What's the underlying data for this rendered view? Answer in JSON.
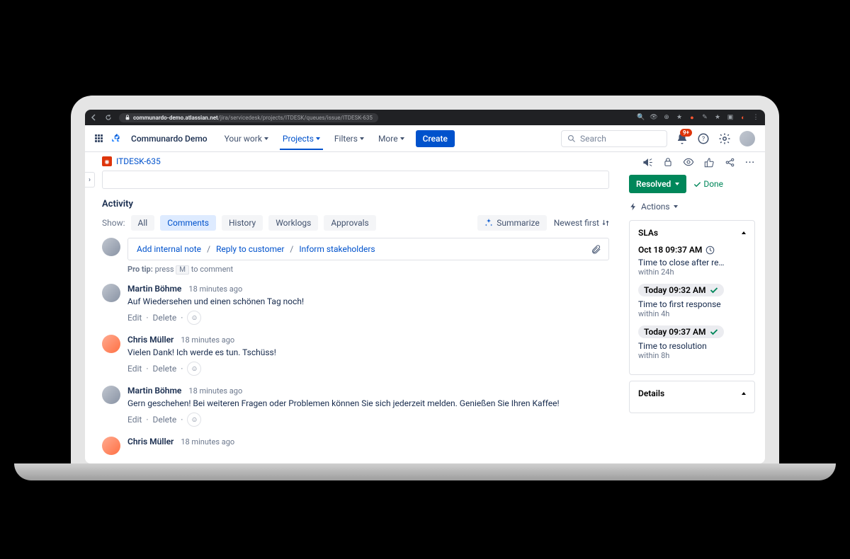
{
  "browser": {
    "url_host": "communardo-demo.atlassian.net",
    "url_path": "/jira/servicedesk/projects/ITDESK/queues/issue/ITDESK-635"
  },
  "topnav": {
    "site": "Communardo Demo",
    "items": [
      "Your work",
      "Projects",
      "Filters",
      "More"
    ],
    "active_index": 1,
    "create": "Create",
    "search_placeholder": "Search",
    "notif_count": "9+"
  },
  "issue": {
    "key": "ITDESK-635"
  },
  "activity": {
    "title": "Activity",
    "show_label": "Show:",
    "tabs": [
      "All",
      "Comments",
      "History",
      "Worklogs",
      "Approvals"
    ],
    "active_tab": 1,
    "summarize": "Summarize",
    "sort": "Newest first",
    "compose_links": [
      "Add internal note",
      "Reply to customer",
      "Inform stakeholders"
    ],
    "protip_prefix": "Pro tip:",
    "protip_press": "press",
    "protip_key": "M",
    "protip_suffix": "to comment",
    "edit": "Edit",
    "delete": "Delete",
    "comments": [
      {
        "author": "Martin Böhme",
        "time": "18 minutes ago",
        "text": "Auf Wiedersehen und einen schönen Tag noch!",
        "avatar": 1
      },
      {
        "author": "Chris Müller",
        "time": "18 minutes ago",
        "text": "Vielen Dank! Ich werde es tun. Tschüss!",
        "avatar": 2
      },
      {
        "author": "Martin Böhme",
        "time": "18 minutes ago",
        "text": "Gern geschehen! Bei weiteren Fragen oder Problemen können Sie sich jederzeit melden. Genießen Sie Ihren Kaffee!",
        "avatar": 1
      },
      {
        "author": "Chris Müller",
        "time": "18 minutes ago",
        "text": "",
        "avatar": 2
      }
    ]
  },
  "side": {
    "status": "Resolved",
    "done": "Done",
    "actions": "Actions",
    "slas_title": "SLAs",
    "details_title": "Details",
    "slas": [
      {
        "date": "Oct 18 09:37 AM",
        "desc": "Time to close after re…",
        "sub": "within 24h",
        "icon": "clock"
      },
      {
        "date": "Today 09:32 AM",
        "desc": "Time to first response",
        "sub": "within 4h",
        "icon": "check",
        "pill": true
      },
      {
        "date": "Today 09:37 AM",
        "desc": "Time to resolution",
        "sub": "within 8h",
        "icon": "check",
        "pill": true
      }
    ]
  }
}
